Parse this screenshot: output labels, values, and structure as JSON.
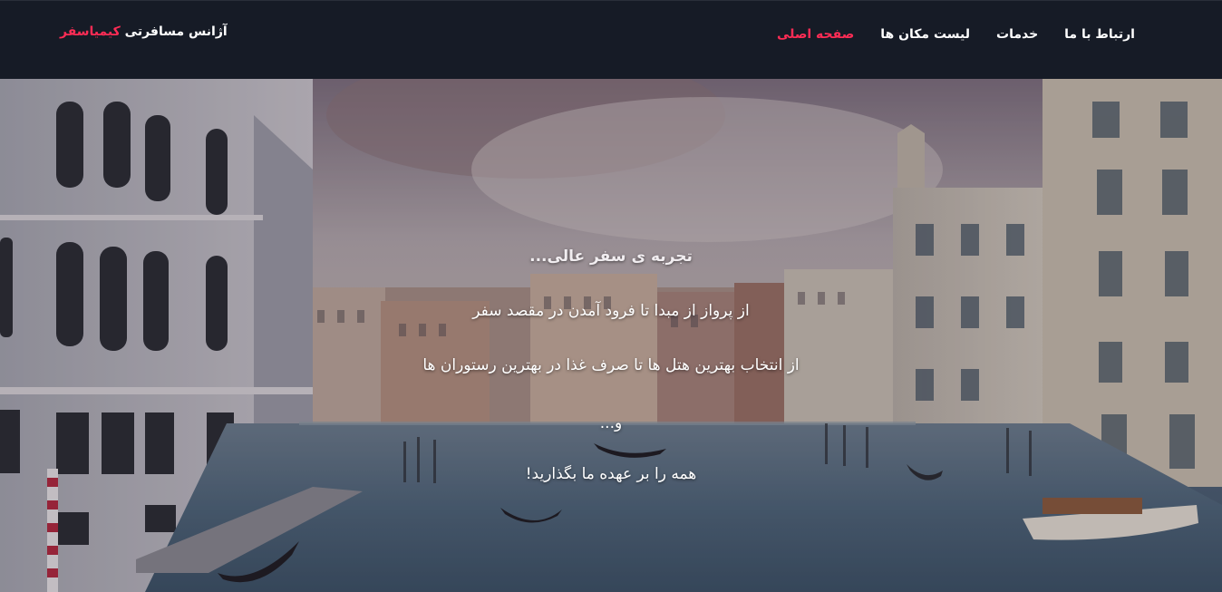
{
  "navbar": {
    "brand_prefix": "آژانس مسافرتی",
    "brand_name": "کیمیاسفر",
    "links": [
      {
        "label": "صفحه اصلی",
        "active": true
      },
      {
        "label": "لیست مکان ها",
        "active": false
      },
      {
        "label": "خدمات",
        "active": false
      },
      {
        "label": "ارتباط با ما",
        "active": false
      }
    ]
  },
  "colors": {
    "navbar_bg": "#161b26",
    "accent": "#ff2c55",
    "text": "#ffffff"
  },
  "hero": {
    "title": "تجربه ی سفر عالی...",
    "lines": [
      "از پرواز از مبدا تا فرود آمدن در مقصد سفر",
      "از انتخاب بهترین هتل ها تا صرف غذا در بهترین رستوران ها",
      "و...",
      "همه را بر عهده ما بگذارید!"
    ]
  }
}
